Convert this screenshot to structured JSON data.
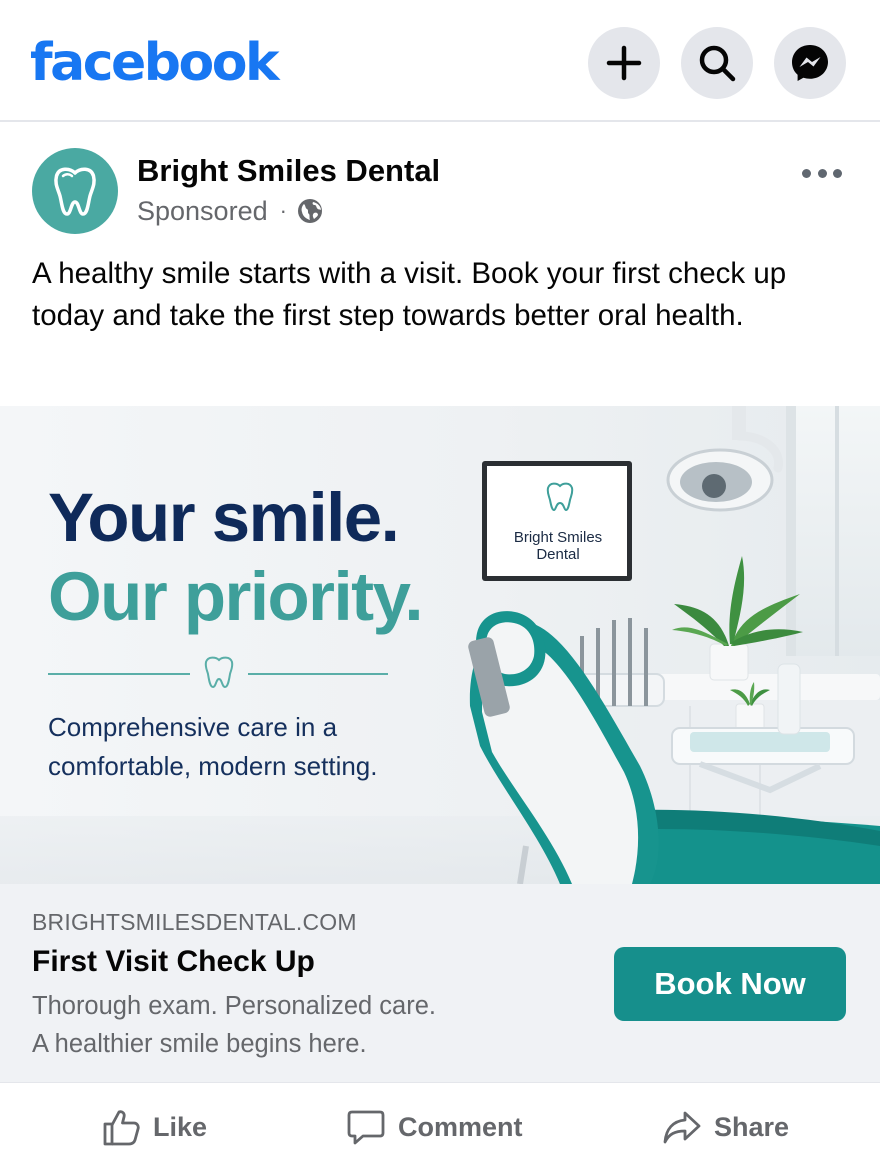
{
  "header": {
    "logo_text": "facebook",
    "brand_color": "#1877f2",
    "buttons": [
      {
        "icon": "plus-icon"
      },
      {
        "icon": "search-icon"
      },
      {
        "icon": "messenger-icon"
      }
    ]
  },
  "post": {
    "page_name": "Bright Smiles Dental",
    "sponsored_label": "Sponsored",
    "separator": "·",
    "audience_icon": "globe-icon",
    "caption": "A healthy smile starts with a visit. Book your first check up today and take the first step towards better oral health."
  },
  "creative": {
    "headline_1": "Your smile.",
    "headline_2": "Our priority.",
    "subtext": "Comprehensive care in a comfortable, modern setting.",
    "monitor_line_1": "Bright Smiles",
    "monitor_line_2": "Dental",
    "colors": {
      "navy": "#0f2a5a",
      "teal": "#3e9f9a"
    }
  },
  "link": {
    "domain": "BRIGHTSMILESDENTAL.COM",
    "title": "First Visit Check Up",
    "desc_line_1": "Thorough exam. Personalized care.",
    "desc_line_2": "A healthier smile begins here.",
    "cta_label": "Book Now",
    "cta_color": "#168f8c"
  },
  "actions": {
    "like": "Like",
    "comment": "Comment",
    "share": "Share"
  }
}
